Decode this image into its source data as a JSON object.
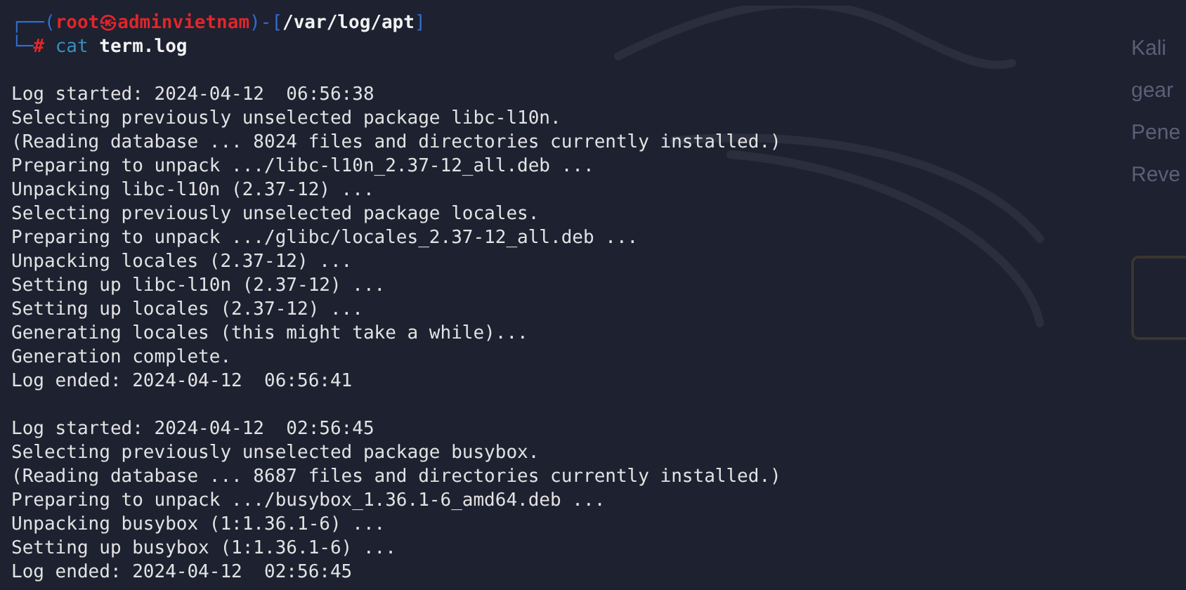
{
  "prompt": {
    "open": "┌──(",
    "user": "root",
    "at": "㉿",
    "host": "adminvietnam",
    "mid": ")-[",
    "path": "/var/log/apt",
    "close": "]",
    "corner": "└─",
    "symbol": "#",
    "command": "cat",
    "argument": "term.log"
  },
  "sessions": [
    [
      "Log started: 2024-04-12  06:56:38",
      "Selecting previously unselected package libc-l10n.",
      "(Reading database ... 8024 files and directories currently installed.)",
      "Preparing to unpack .../libc-l10n_2.37-12_all.deb ...",
      "Unpacking libc-l10n (2.37-12) ...",
      "Selecting previously unselected package locales.",
      "Preparing to unpack .../glibc/locales_2.37-12_all.deb ...",
      "Unpacking locales (2.37-12) ...",
      "Setting up libc-l10n (2.37-12) ...",
      "Setting up locales (2.37-12) ...",
      "Generating locales (this might take a while)...",
      "Generation complete.",
      "Log ended: 2024-04-12  06:56:41"
    ],
    [
      "Log started: 2024-04-12  02:56:45",
      "Selecting previously unselected package busybox.",
      "(Reading database ... 8687 files and directories currently installed.)",
      "Preparing to unpack .../busybox_1.36.1-6_amd64.deb ...",
      "Unpacking busybox (1:1.36.1-6) ...",
      "Setting up busybox (1:1.36.1-6) ...",
      "Log ended: 2024-04-12  02:56:45"
    ]
  ],
  "background_panel": {
    "lines": [
      "Kali",
      "gear",
      "Pene",
      "Reve"
    ]
  }
}
